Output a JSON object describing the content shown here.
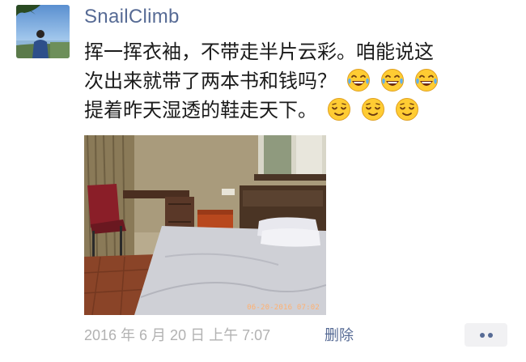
{
  "user": {
    "name": "SnailClimb"
  },
  "post": {
    "lines": [
      "挥一挥衣袖，不带走半片云彩。咱能说这",
      "次出来就带了两本书和钱吗？",
      "提着昨天湿透的鞋走天下。"
    ],
    "emoji": [
      "tears-of-joy-icon",
      "relieved-face-icon"
    ],
    "photo_stamp": "06-20-2016 07:02"
  },
  "meta": {
    "timestamp": "2016 年 6 月 20 日  上午 7:07",
    "delete_label": "删除"
  },
  "colors": {
    "link": "#576b95",
    "meta": "#b2b2b2",
    "text": "#1b1b1b"
  }
}
